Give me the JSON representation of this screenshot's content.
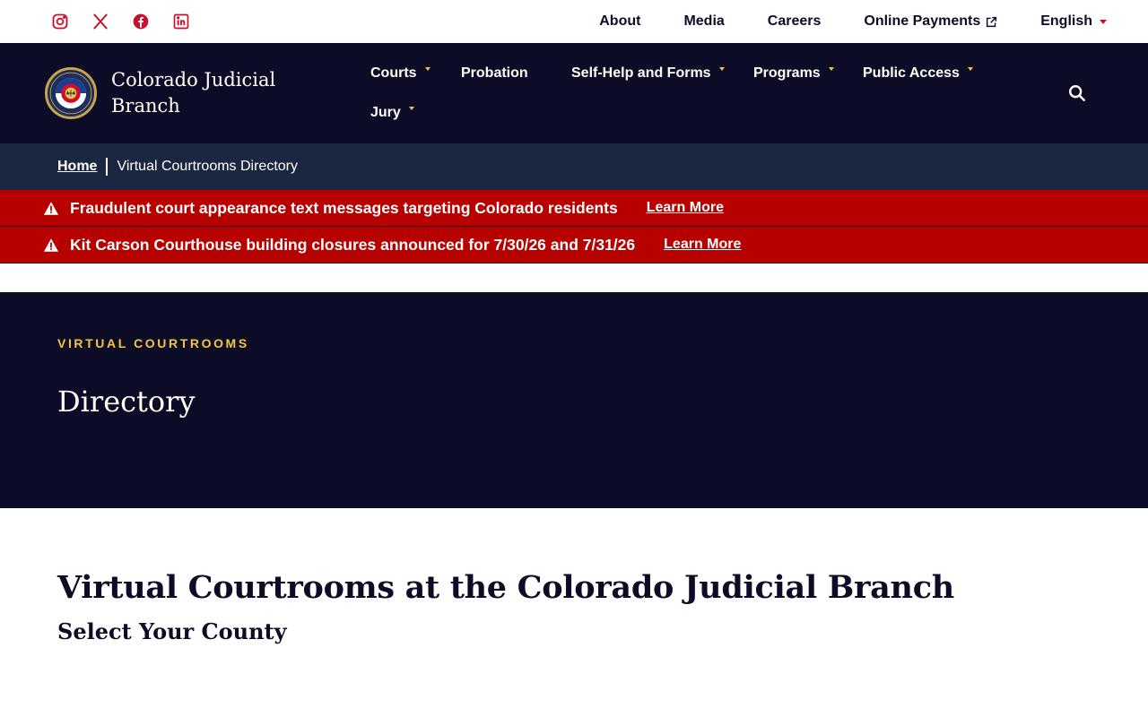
{
  "utility": {
    "social": [
      {
        "name": "instagram-icon"
      },
      {
        "name": "x-twitter-icon"
      },
      {
        "name": "facebook-icon"
      },
      {
        "name": "linkedin-icon"
      }
    ],
    "links": {
      "about": "About",
      "media": "Media",
      "careers": "Careers",
      "online_payments": "Online Payments",
      "language": "English"
    }
  },
  "header": {
    "brand_line1": "Colorado Judicial",
    "brand_line2": "Branch",
    "nav": {
      "courts": "Courts",
      "probation": "Probation",
      "self_help": "Self-Help and Forms",
      "programs": "Programs",
      "public_access": "Public Access",
      "jury": "Jury"
    }
  },
  "breadcrumb": {
    "home": "Home",
    "current": "Virtual Courtrooms Directory"
  },
  "alerts": [
    {
      "text": "Fraudulent court appearance text messages targeting Colorado residents",
      "link": "Learn More"
    },
    {
      "text": "Kit Carson Courthouse building closures announced for 7/30/26 and 7/31/26",
      "link": "Learn More"
    }
  ],
  "hero": {
    "eyebrow": "VIRTUAL COURTROOMS",
    "title": "Directory"
  },
  "content": {
    "heading": "Virtual Courtrooms at the Colorado Judicial Branch",
    "subheading": "Select Your County"
  },
  "colors": {
    "navy": "#0d0c27",
    "breadcrumb_bg": "#1b2740",
    "alert_red": "#b70000",
    "accent_gold": "#f4c542",
    "social_red": "#c8102e"
  }
}
